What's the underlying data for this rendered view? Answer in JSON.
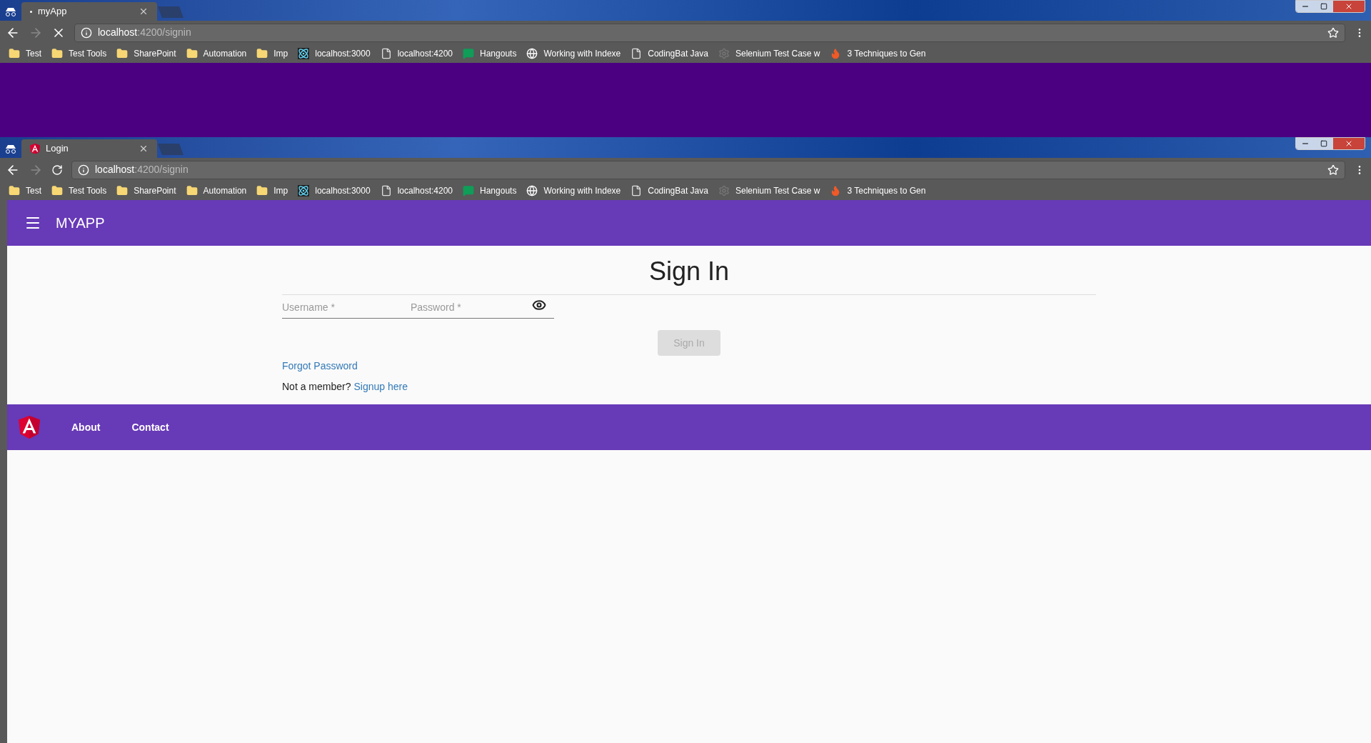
{
  "windows": [
    {
      "tab": {
        "title": "myApp",
        "kind": "loading"
      },
      "loading": true,
      "url": {
        "host": "localhost",
        "rest": ":4200/signin"
      },
      "bookmarks": [
        {
          "label": "Test",
          "kind": "folder"
        },
        {
          "label": "Test Tools",
          "kind": "folder"
        },
        {
          "label": "SharePoint",
          "kind": "folder"
        },
        {
          "label": "Automation",
          "kind": "folder"
        },
        {
          "label": "Imp",
          "kind": "folder"
        },
        {
          "label": "localhost:3000",
          "kind": "atom"
        },
        {
          "label": "localhost:4200",
          "kind": "page"
        },
        {
          "label": "Hangouts",
          "kind": "chat"
        },
        {
          "label": "Working with Indexe",
          "kind": "globe"
        },
        {
          "label": "CodingBat Java",
          "kind": "page"
        },
        {
          "label": "Selenium Test Case w",
          "kind": "gear"
        },
        {
          "label": "3 Techniques to Gen",
          "kind": "flame"
        }
      ]
    },
    {
      "tab": {
        "title": "Login",
        "kind": "angular"
      },
      "loading": false,
      "url": {
        "host": "localhost",
        "rest": ":4200/signin"
      },
      "bookmarks": [
        {
          "label": "Test",
          "kind": "folder"
        },
        {
          "label": "Test Tools",
          "kind": "folder"
        },
        {
          "label": "SharePoint",
          "kind": "folder"
        },
        {
          "label": "Automation",
          "kind": "folder"
        },
        {
          "label": "Imp",
          "kind": "folder"
        },
        {
          "label": "localhost:3000",
          "kind": "atom"
        },
        {
          "label": "localhost:4200",
          "kind": "page"
        },
        {
          "label": "Hangouts",
          "kind": "chat"
        },
        {
          "label": "Working with Indexe",
          "kind": "globe"
        },
        {
          "label": "CodingBat Java",
          "kind": "page"
        },
        {
          "label": "Selenium Test Case w",
          "kind": "gear"
        },
        {
          "label": "3 Techniques to Gen",
          "kind": "flame"
        }
      ]
    }
  ],
  "app": {
    "brand": "MYAPP",
    "title": "Sign In",
    "username": {
      "placeholder": "Username *"
    },
    "password": {
      "placeholder": "Password *"
    },
    "submit": {
      "label": "Sign In",
      "disabled": true
    },
    "forgot": "Forgot Password",
    "signup_prompt": "Not a member?",
    "signup_link": "Signup here",
    "footer_links": [
      "About",
      "Contact"
    ]
  }
}
